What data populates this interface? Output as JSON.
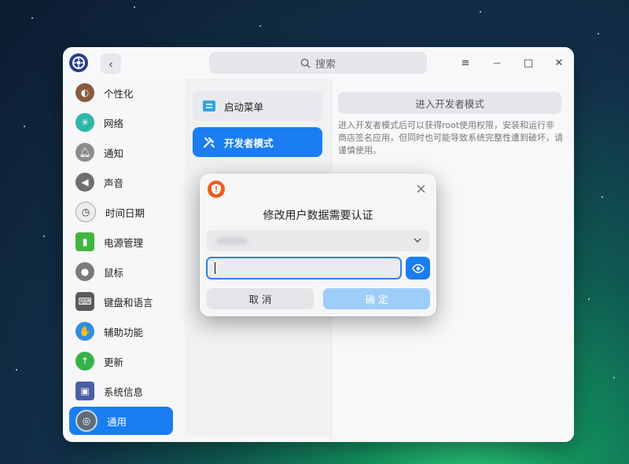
{
  "window": {
    "back_label": "‹",
    "search_placeholder": "搜索",
    "menu_label": "≡",
    "minimize_label": "—",
    "maximize_label": "□",
    "close_label": "✕"
  },
  "sidebar": {
    "items": [
      {
        "label": "个性化",
        "icon": "palette-icon",
        "color": "#8a5a3c"
      },
      {
        "label": "网络",
        "icon": "network-icon",
        "color": "#2cb7a8"
      },
      {
        "label": "通知",
        "icon": "bell-icon",
        "color": "#8d8d8d"
      },
      {
        "label": "声音",
        "icon": "speaker-icon",
        "color": "#6f6f6f"
      },
      {
        "label": "时间日期",
        "icon": "clock-icon",
        "color": "#e9e9e9"
      },
      {
        "label": "电源管理",
        "icon": "battery-icon",
        "color": "#3fb53f"
      },
      {
        "label": "鼠标",
        "icon": "mouse-icon",
        "color": "#7b7b7b"
      },
      {
        "label": "键盘和语言",
        "icon": "keyboard-icon",
        "color": "#5a5a5a"
      },
      {
        "label": "辅助功能",
        "icon": "accessibility-icon",
        "color": "#2f8fe3"
      },
      {
        "label": "更新",
        "icon": "update-icon",
        "color": "#35b24a"
      },
      {
        "label": "系统信息",
        "icon": "system-info-icon",
        "color": "#4a5fa8"
      },
      {
        "label": "通用",
        "icon": "general-icon",
        "color": "#5d6d7a",
        "active": true
      }
    ]
  },
  "middle": {
    "items": [
      {
        "label": "启动菜单",
        "icon": "boot-menu-icon",
        "active": false
      },
      {
        "label": "开发者模式",
        "icon": "developer-tools-icon",
        "active": true
      }
    ]
  },
  "right": {
    "dev_button": "进入开发者模式",
    "description": "进入开发者模式后可以获得root使用权限，安装和运行非商店签名应用，但同时也可能导致系统完整性遭到破坏，请谨慎使用。"
  },
  "dialog": {
    "title": "修改用户数据需要认证",
    "password_value": "",
    "cancel": "取 消",
    "confirm": "确 定"
  },
  "colors": {
    "accent": "#1a7df2",
    "disabled_accent": "#9fcdfa",
    "shield": "#f05a1a"
  }
}
